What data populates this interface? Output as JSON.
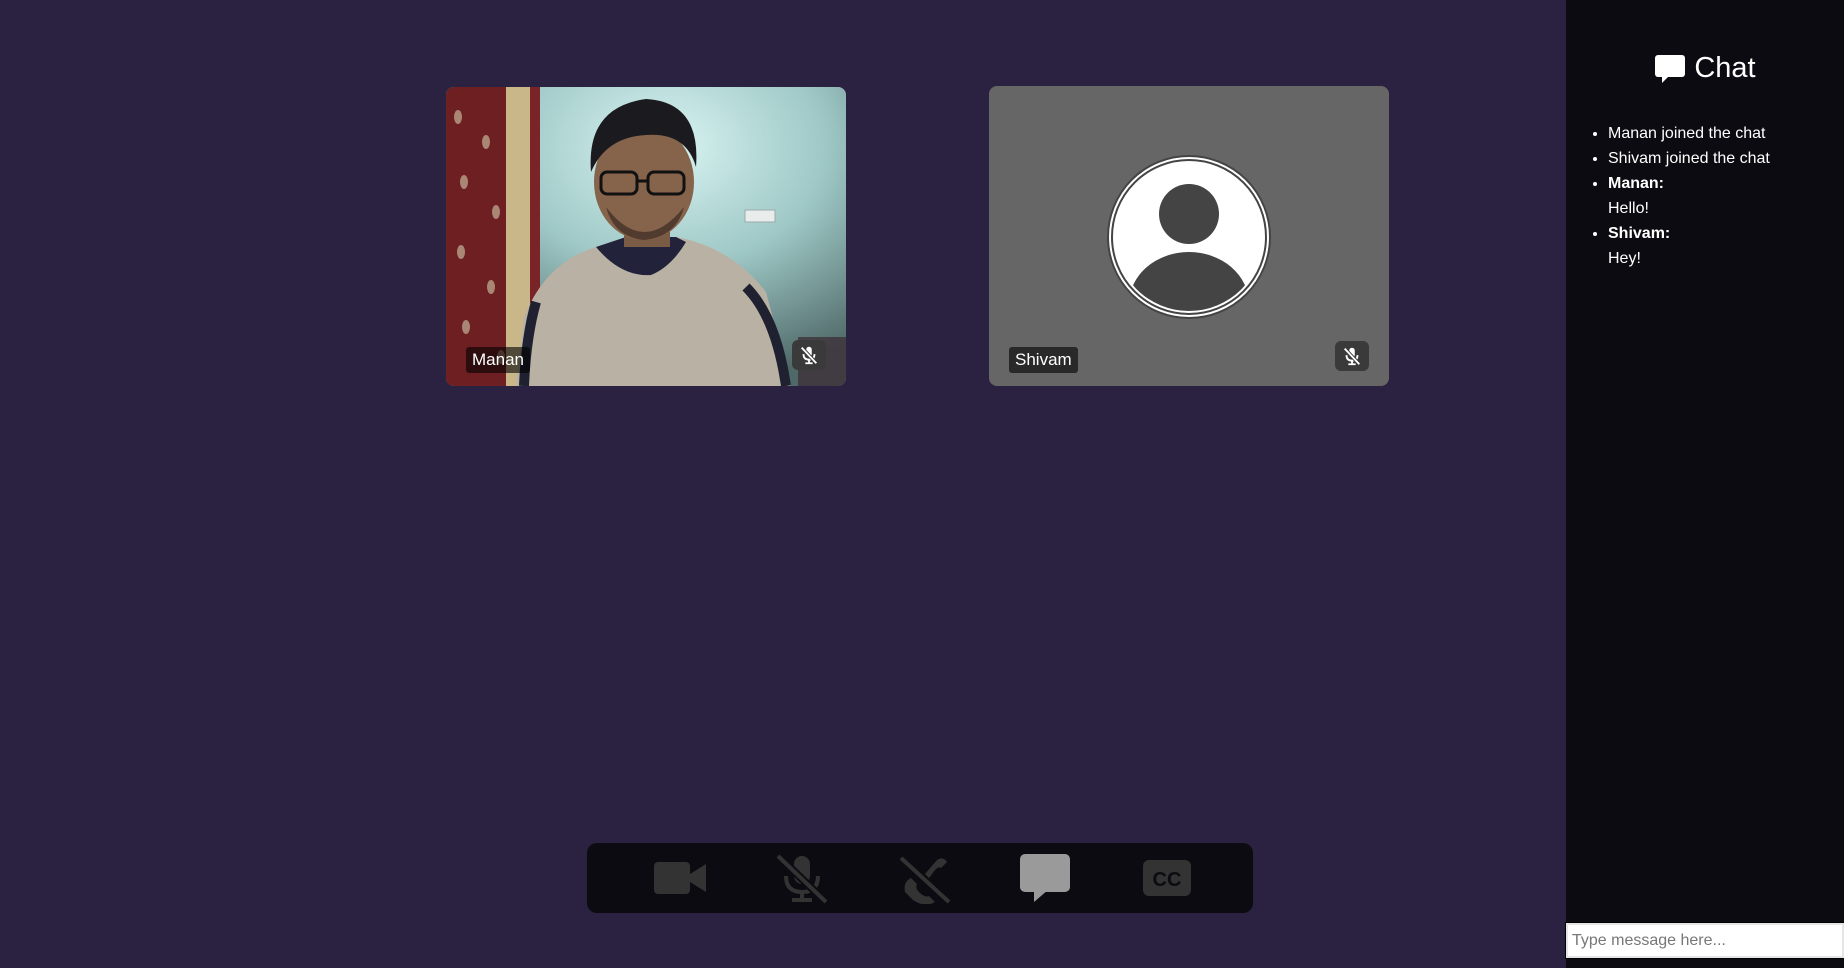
{
  "participants": [
    {
      "name": "Manan",
      "mic_state": "muted",
      "video": "on"
    },
    {
      "name": "Shivam",
      "mic_state": "muted",
      "video": "off"
    }
  ],
  "toolbar": {
    "buttons": [
      {
        "icon": "video-camera-icon"
      },
      {
        "icon": "microphone-muted-icon"
      },
      {
        "icon": "end-call-icon"
      },
      {
        "icon": "chat-bubble-icon"
      },
      {
        "icon": "closed-captions-icon"
      }
    ]
  },
  "chat": {
    "title": "Chat",
    "messages": [
      {
        "type": "system",
        "text": "Manan joined the chat"
      },
      {
        "type": "system",
        "text": "Shivam joined the chat"
      },
      {
        "type": "message",
        "sender": "Manan:",
        "text": "Hello!"
      },
      {
        "type": "message",
        "sender": "Shivam:",
        "text": "Hey!"
      }
    ],
    "input_placeholder": "Type message here...",
    "input_value": ""
  },
  "colors": {
    "main_background": "#2b2140",
    "panel_background": "#0c0b11",
    "tile_off_background": "#666666"
  }
}
